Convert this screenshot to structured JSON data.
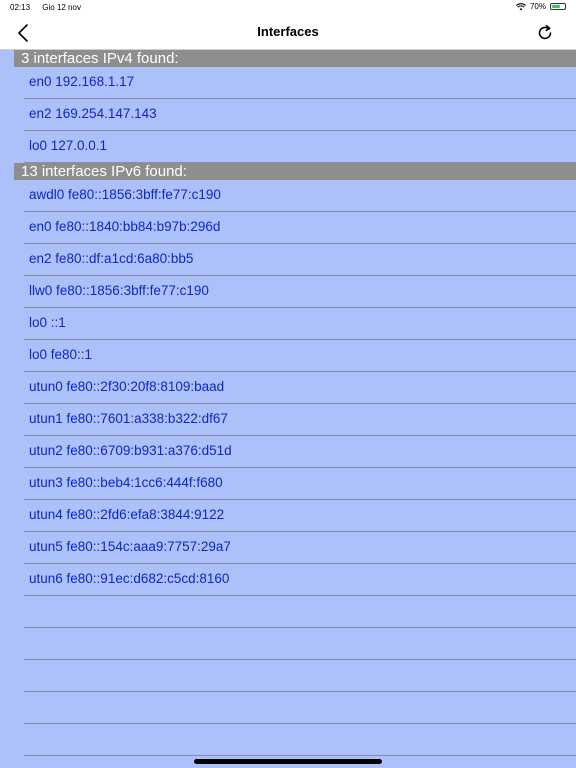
{
  "status_bar": {
    "time": "02:13",
    "date": "Gio 12 nov",
    "battery_percent": "70%",
    "battery_level": 0.7
  },
  "navbar": {
    "title": "Interfaces",
    "back_icon": "chevron-left-icon",
    "refresh_icon": "refresh-icon"
  },
  "sections": [
    {
      "header": "3 interfaces IPv4 found:",
      "rows": [
        "en0 192.168.1.17",
        "en2 169.254.147.143",
        "lo0 127.0.0.1"
      ]
    },
    {
      "header": "13 interfaces IPv6 found:",
      "rows": [
        "awdl0 fe80::1856:3bff:fe77:c190",
        "en0 fe80::1840:bb84:b97b:296d",
        "en2 fe80::df:a1cd:6a80:bb5",
        "llw0 fe80::1856:3bff:fe77:c190",
        "lo0 ::1",
        "lo0 fe80::1",
        "utun0 fe80::2f30:20f8:8109:baad",
        "utun1 fe80::7601:a338:b322:df67",
        "utun2 fe80::6709:b931:a376:d51d",
        "utun3 fe80::beb4:1cc6:444f:f680",
        "utun4 fe80::2fd6:efa8:3844:9122",
        "utun5 fe80::154c:aaa9:7757:29a7",
        "utun6 fe80::91ec:d682:c5cd:8160"
      ]
    }
  ],
  "empty_rows": 5,
  "colors": {
    "background": "#acc0fa",
    "section_header": "#8e8e8e",
    "row_text": "#1226c4"
  }
}
